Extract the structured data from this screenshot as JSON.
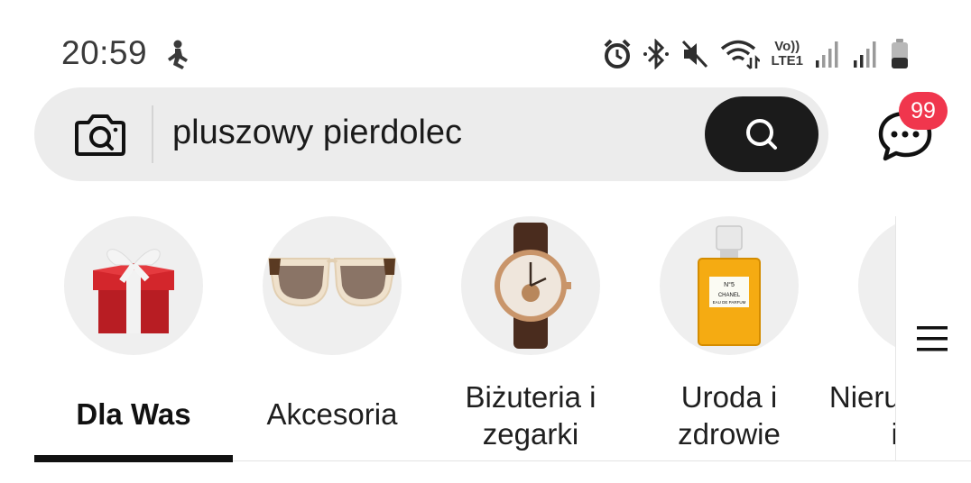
{
  "status_bar": {
    "time": "20:59",
    "left_icon": "fitness-person-icon",
    "right_icons": [
      "alarm-icon",
      "bluetooth-icon",
      "muted-icon",
      "wifi-icon",
      "volte-lte-icon",
      "signal-icon",
      "signal-icon",
      "battery-icon"
    ],
    "volte_label_top": "Vo))",
    "volte_label_bottom": "LTE1"
  },
  "search": {
    "value": "pluszowy pierdolec",
    "camera_icon": "camera-icon",
    "search_icon": "search-icon"
  },
  "chat": {
    "icon": "chat-icon",
    "badge": "99",
    "badge_color": "#f0364d"
  },
  "categories": [
    {
      "label": "Dla Was",
      "icon": "gift-icon",
      "active": true
    },
    {
      "label": "Akcesoria",
      "icon": "sunglasses-icon",
      "active": false
    },
    {
      "label_line1": "Biżuteria i",
      "label_line2": "zegarki",
      "icon": "watch-icon",
      "active": false
    },
    {
      "label_line1": "Uroda i",
      "label_line2": "zdrowie",
      "icon": "perfume-icon",
      "active": false
    },
    {
      "label_line1": "Nieruchomości",
      "label_line2": "i dom",
      "icon": "home-icon",
      "active": false
    }
  ],
  "perfume_label_top": "N°5",
  "perfume_label_brand": "CHANEL",
  "perfume_label_bottom": "EAU DE PARFUM",
  "menu_icon": "hamburger-menu-icon",
  "colors": {
    "accent": "#111111",
    "search_bg": "#ececec",
    "search_button": "#1b1b1b",
    "badge": "#f0364d"
  }
}
